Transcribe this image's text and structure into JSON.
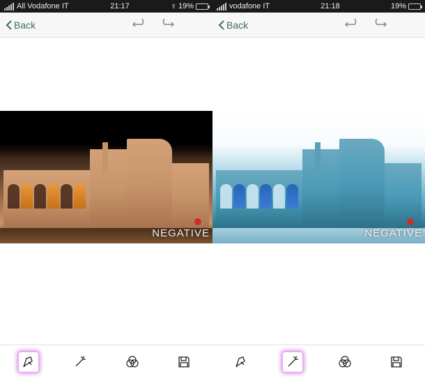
{
  "left": {
    "status": {
      "carrier": "All Vodafone IT",
      "time": "21:17",
      "battery": "19%"
    },
    "nav": {
      "back_label": "Back"
    },
    "photo": {
      "filter_label": "NEGATIVE"
    },
    "toolbar": {
      "active_index": 0
    }
  },
  "right": {
    "status": {
      "carrier": "vodafone IT",
      "time": "21:18",
      "battery": "19%"
    },
    "nav": {
      "back_label": "Back"
    },
    "photo": {
      "filter_label": "NEGATIVE"
    },
    "toolbar": {
      "active_index": 1
    }
  },
  "tools": [
    "pen-tool",
    "wand-tool",
    "channels-tool",
    "save-tool"
  ]
}
